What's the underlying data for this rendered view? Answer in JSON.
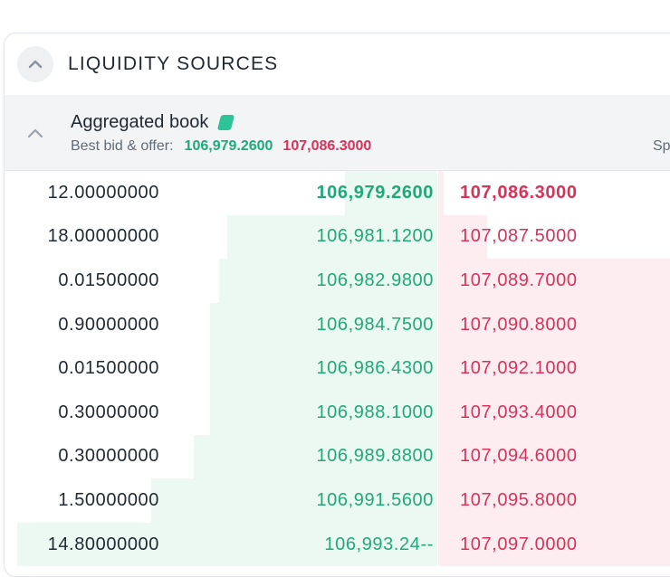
{
  "panel": {
    "title": "LIQUIDITY SOURCES"
  },
  "book": {
    "title": "Aggregated book",
    "bbo_label": "Best bid & offer:",
    "best_bid": "106,979.2600",
    "best_offer": "107,086.3000",
    "spread_label": "Sp"
  },
  "colors": {
    "bid": "#1fa97a",
    "ask": "#d8325a",
    "bid_depth_bg": "#ecf8f2",
    "ask_depth_bg": "#fdedf0",
    "tag": "#2ec49a"
  },
  "icons": {
    "panel_toggle": "chevron-up-icon",
    "book_toggle": "chevron-up-icon",
    "book_tag": "tag-icon"
  },
  "rows": [
    {
      "qty": "12.00000000",
      "bid": "106,979.2600",
      "ask": "107,086.3000",
      "bid_depth": 0.22,
      "ask_depth": 0.02
    },
    {
      "qty": "18.00000000",
      "bid": "106,981.1200",
      "ask": "107,087.5000",
      "bid_depth": 0.5,
      "ask_depth": 0.18
    },
    {
      "qty": "0.01500000",
      "bid": "106,982.9800",
      "ask": "107,089.7000",
      "bid_depth": 0.52,
      "ask_depth": 0.9
    },
    {
      "qty": "0.90000000",
      "bid": "106,984.7500",
      "ask": "107,090.8000",
      "bid_depth": 0.54,
      "ask_depth": 0.9
    },
    {
      "qty": "0.01500000",
      "bid": "106,986.4300",
      "ask": "107,092.1000",
      "bid_depth": 0.54,
      "ask_depth": 0.9
    },
    {
      "qty": "0.30000000",
      "bid": "106,988.1000",
      "ask": "107,093.4000",
      "bid_depth": 0.54,
      "ask_depth": 0.9
    },
    {
      "qty": "0.30000000",
      "bid": "106,989.8800",
      "ask": "107,094.6000",
      "bid_depth": 0.58,
      "ask_depth": 0.9
    },
    {
      "qty": "1.50000000",
      "bid": "106,991.5600",
      "ask": "107,095.8000",
      "bid_depth": 0.68,
      "ask_depth": 0.9
    },
    {
      "qty": "14.80000000",
      "bid": "106,993.24--",
      "ask": "107,097.0000",
      "bid_depth": 1.0,
      "ask_depth": 0.9
    }
  ]
}
